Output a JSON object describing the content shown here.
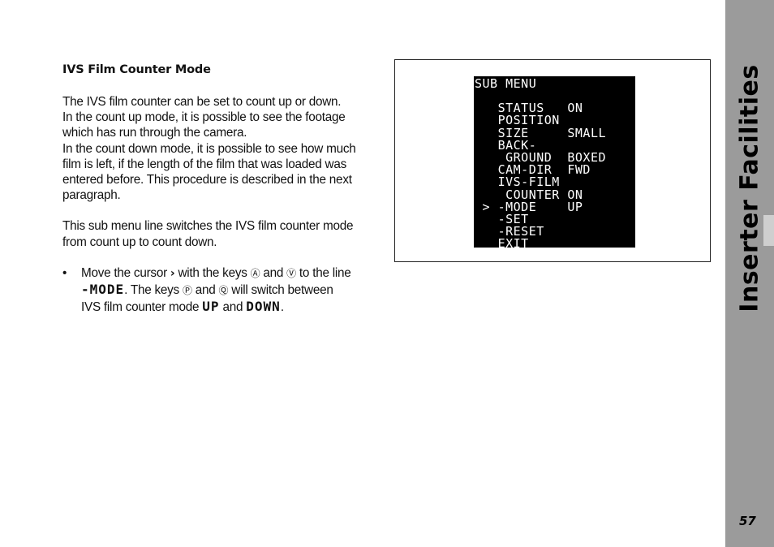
{
  "section": {
    "heading": "IVS Film Counter Mode",
    "para1": [
      "The IVS film counter can be set to count up or down.",
      "In the count up mode, it is possible to see the footage",
      "which has run through the camera.",
      "In the count down mode, it is possible to see how much",
      "film is left, if the length of the film that was loaded was",
      "entered before. This procedure is described in the next",
      "paragraph."
    ],
    "para2": [
      "This sub menu line switches the IVS film counter mode",
      "from count up to count down."
    ],
    "bullet": {
      "dot": "•",
      "t1": "Move the cursor ",
      "cursor_glyph": "›",
      "t2": " with the keys ",
      "key_up": "Ⓐ",
      "t3": " and ",
      "key_down": "Ⓥ",
      "t4": " to the line",
      "line_name": "-MODE",
      "t5": ". The keys ",
      "key_right": "Ⓟ",
      "t6": " and ",
      "key_left": "Ⓠ",
      "t7": " will switch between",
      "t8": "IVS film counter mode ",
      "mode_up": "UP",
      "t9": " and ",
      "mode_down": "DOWN",
      "t10": "."
    }
  },
  "screen": {
    "title": "SUB MENU",
    "rows": [
      "   STATUS   ON",
      "   POSITION",
      "   SIZE     SMALL",
      "   BACK-",
      "    GROUND  BOXED",
      "   CAM-DIR  FWD",
      "   IVS-FILM",
      "    COUNTER ON",
      " > -MODE    UP",
      "   -SET",
      "   -RESET",
      "   EXIT"
    ]
  },
  "sidebar": {
    "title": "Inserter Facilities",
    "page_number": "57"
  }
}
